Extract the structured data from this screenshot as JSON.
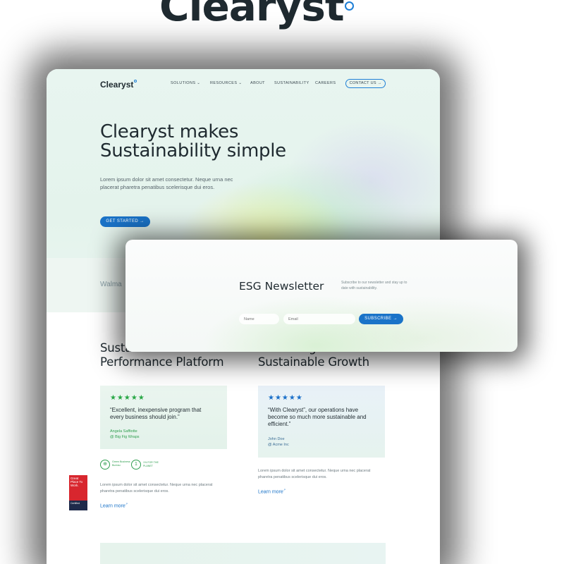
{
  "brand": {
    "name": "Clearyst"
  },
  "nav": {
    "logo": "Clearyst",
    "items": [
      "SOLUTIONS ⌄",
      "RESOURCES ⌄",
      "ABOUT",
      "SUSTAINABILITY",
      "CAREERS"
    ],
    "contact": "CONTACT US →"
  },
  "hero": {
    "title_line1": "Clearyst makes",
    "title_line2": "Sustainability simple",
    "body": "Lorem ipsum dolor sit amet consectetur. Neque urna nec placerat pharetra penatibus scelerisque dui eros.",
    "cta": "GET STARTED →",
    "partner_logo": "Walma"
  },
  "newsletter": {
    "title": "ESG Newsletter",
    "subtitle": "Subscribe to our newsletter and stay up to date with sustainability.",
    "name_placeholder": "Name",
    "email_placeholder": "Email",
    "button": "SUBSCRIBE →"
  },
  "section_left": {
    "title_line1": "Susta",
    "title_line2": "Performance Platform",
    "stars": "★★★★★",
    "quote": "“Excellent, inexpensive program that every business should join.”",
    "author": "Angela Saffiotte",
    "company": "@ Big Fig Wraps",
    "badge1_text": "Green Business Bureau",
    "badge2_text": "1% FOR THE PLANET",
    "body": "Lorem ipsum dolor sit amet consectetur. Neque urna nec placerat pharetra penatibus scelerisque dui eros.",
    "learn_more": "Learn more"
  },
  "section_right": {
    "title_line1": "g",
    "title_line2": "Sustainable Growth",
    "stars": "★★★★★",
    "quote": "“With Clearyst”, our operations have become so much more sustainable and efficient.”",
    "author": "John Doe",
    "company": "@ Acme Inc",
    "body": "Lorem ipsum dolor sit amet consectetur. Neque urna nec placerat pharetra penatibus scelerisque dui eros.",
    "learn_more": "Learn more"
  },
  "award": {
    "line": "Great Place To Work.",
    "certified": "Certified"
  },
  "colors": {
    "accent": "#1a73c8",
    "green": "#2f9e4f",
    "star_blue": "#1a6fc9",
    "star_green": "#28a745"
  }
}
